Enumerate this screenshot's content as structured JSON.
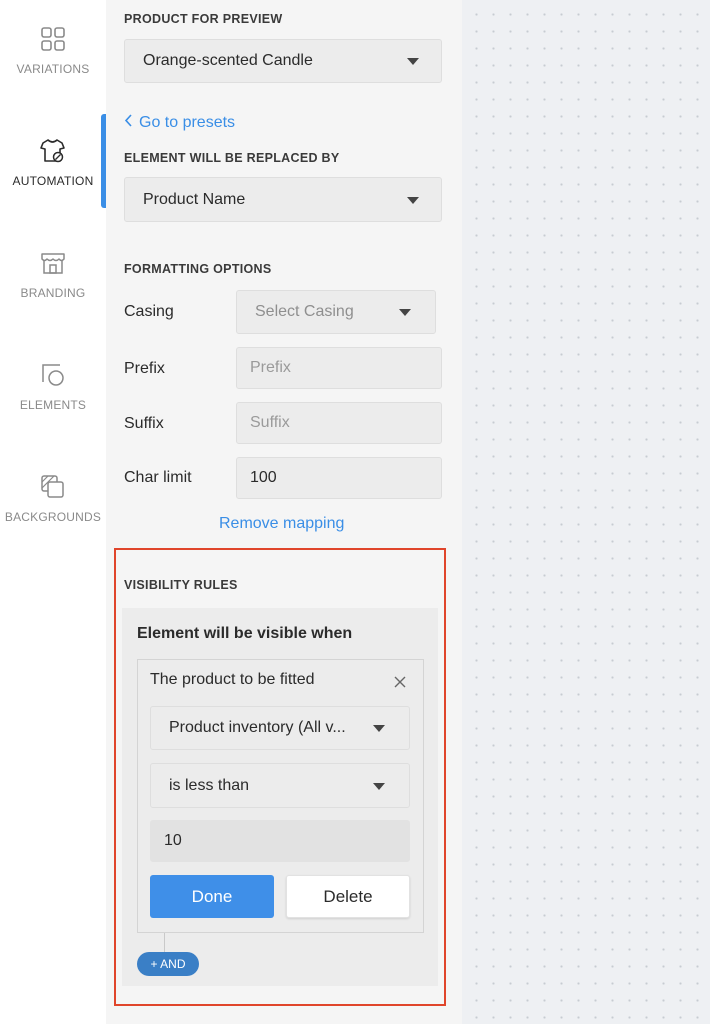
{
  "rail": {
    "items": [
      {
        "label": "VARIATIONS",
        "icon": "grid-icon"
      },
      {
        "label": "AUTOMATION",
        "icon": "tshirt-gear-icon",
        "active": true
      },
      {
        "label": "BRANDING",
        "icon": "storefront-icon"
      },
      {
        "label": "ELEMENTS",
        "icon": "shapes-icon"
      },
      {
        "label": "BACKGROUNDS",
        "icon": "layers-icon"
      }
    ],
    "accent": "#3a8ee6"
  },
  "panel": {
    "preview": {
      "title": "PRODUCT FOR PREVIEW",
      "selected": "Orange-scented Candle"
    },
    "go_to_presets": "Go to presets",
    "replaced_by": {
      "title": "ELEMENT WILL BE REPLACED BY",
      "selected": "Product Name"
    },
    "formatting": {
      "title": "FORMATTING OPTIONS",
      "casing_label": "Casing",
      "casing_placeholder": "Select Casing",
      "prefix_label": "Prefix",
      "prefix_placeholder": "Prefix",
      "suffix_label": "Suffix",
      "suffix_placeholder": "Suffix",
      "char_limit_label": "Char limit",
      "char_limit_value": "100"
    },
    "remove_mapping": "Remove mapping",
    "visibility": {
      "title": "VISIBILITY RULES",
      "subtitle": "Element will be visible when",
      "condition": {
        "heading": "The product to be fitted",
        "attribute": "Product inventory (All v...",
        "operator": "is less than",
        "value": "10",
        "done_label": "Done",
        "delete_label": "Delete"
      },
      "and_label": "+ AND"
    }
  },
  "colors": {
    "highlight_border": "#e0452b",
    "primary_button": "#3f8fe8",
    "link": "#3a8ee6"
  }
}
